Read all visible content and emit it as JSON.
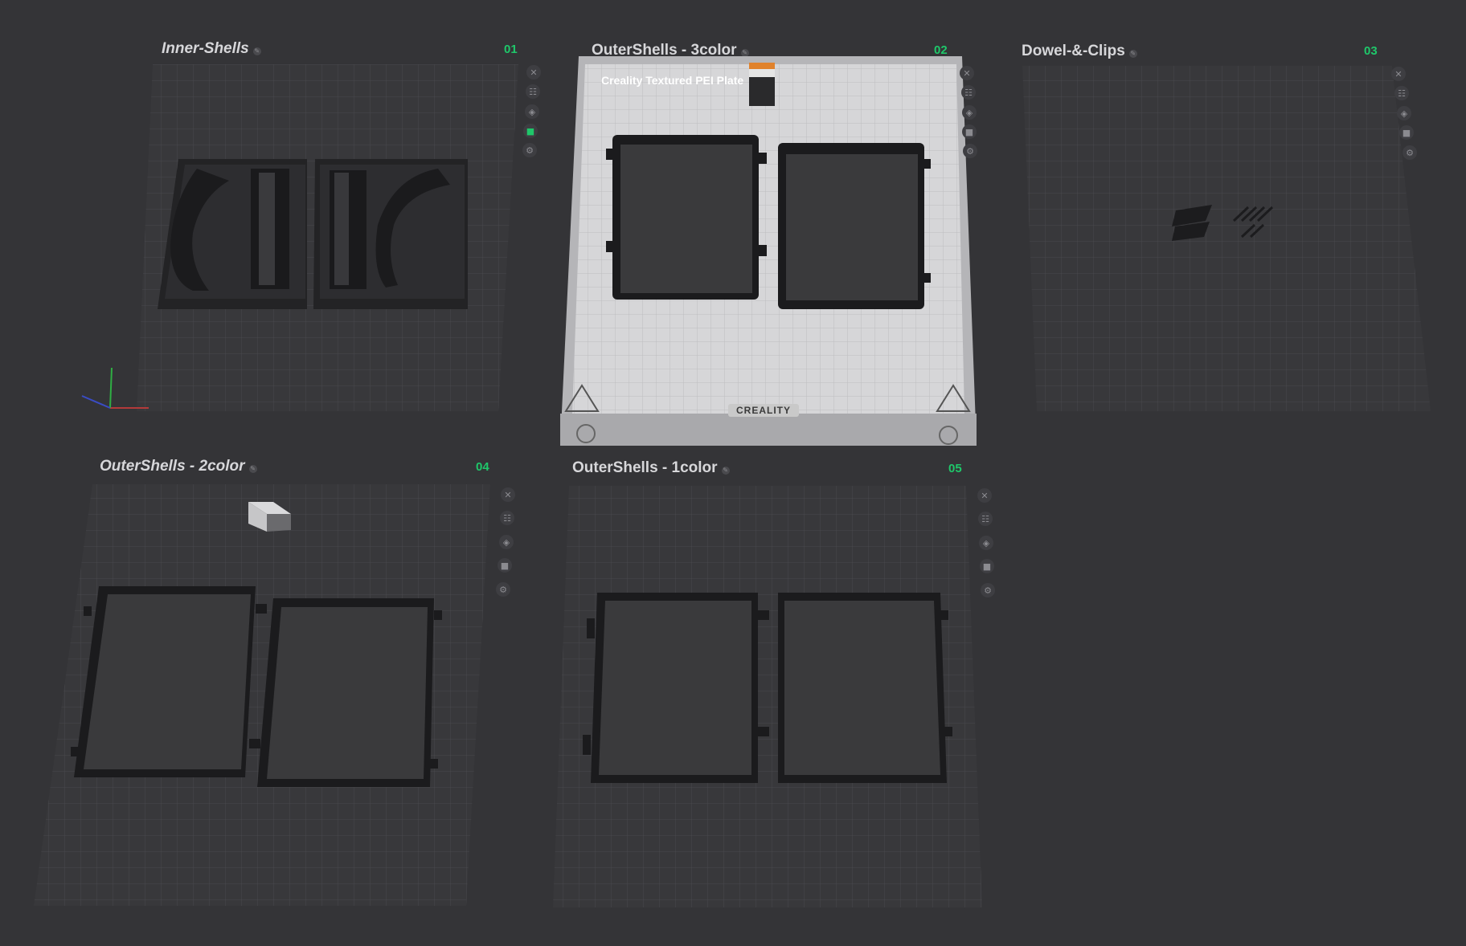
{
  "plates": [
    {
      "name": "Inner-Shells",
      "number": "01",
      "italic": true
    },
    {
      "name": "OuterShells - 3color",
      "number": "02",
      "italic": false
    },
    {
      "name": "Dowel-&-Clips",
      "number": "03",
      "italic": false
    },
    {
      "name": "OuterShells - 2color",
      "number": "04",
      "italic": true
    },
    {
      "name": "OuterShells - 1color",
      "number": "05",
      "italic": false
    }
  ],
  "active_plate": {
    "bed_label": "Creality Textured PEI Plate",
    "brand": "CREALITY"
  },
  "plate_controls": [
    {
      "name": "close",
      "icon": "close-icon",
      "glyph": "✕"
    },
    {
      "name": "arrange",
      "icon": "list-icon",
      "glyph": "☷"
    },
    {
      "name": "orient",
      "icon": "orient-icon",
      "glyph": "◈"
    },
    {
      "name": "lock",
      "icon": "lock-icon",
      "glyph": "🔒"
    },
    {
      "name": "settings",
      "icon": "gear-icon",
      "glyph": "⚙"
    }
  ],
  "colors": {
    "background": "#343437",
    "accent": "#1fc76a",
    "grid": "#4a4a4e",
    "model": "#2b2b2d",
    "active_bed": "#d0d0d2"
  }
}
